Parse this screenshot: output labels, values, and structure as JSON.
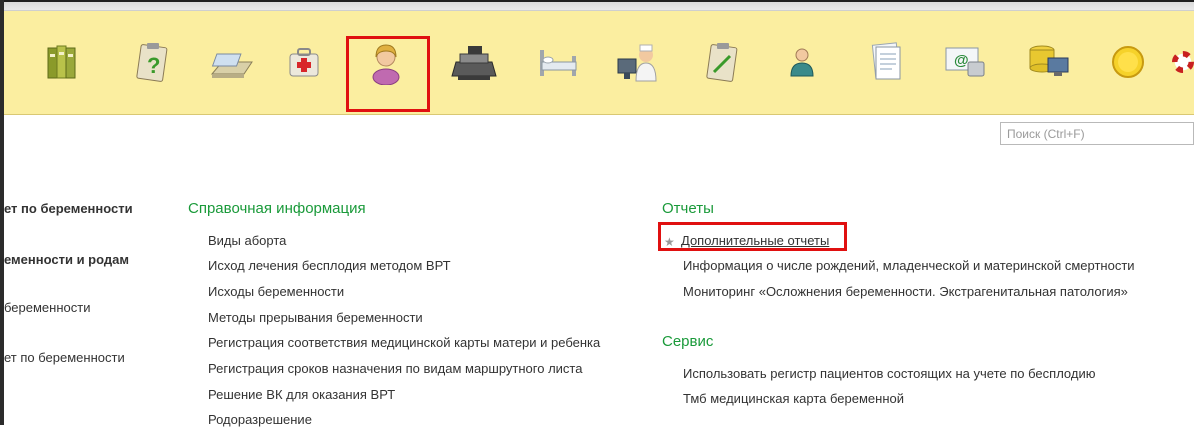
{
  "toolbar": {
    "icons": [
      {
        "name": "books-icon"
      },
      {
        "name": "clipboard-question-icon"
      },
      {
        "name": "document-tray-icon"
      },
      {
        "name": "medical-case-icon"
      },
      {
        "name": "woman-user-icon",
        "selected": true
      },
      {
        "name": "cash-register-icon"
      },
      {
        "name": "hospital-bed-icon"
      },
      {
        "name": "doctor-computer-icon"
      },
      {
        "name": "clipboard-edit-icon"
      },
      {
        "name": "person-icon"
      },
      {
        "name": "documents-stack-icon"
      },
      {
        "name": "mail-phone-icon"
      },
      {
        "name": "database-computer-icon"
      },
      {
        "name": "yellow-circle-icon"
      },
      {
        "name": "lifebuoy-icon"
      }
    ],
    "accent_color": "#fbeea0",
    "highlight_color": "#e01010"
  },
  "search": {
    "placeholder": "Поиск (Ctrl+F)"
  },
  "leftnav": {
    "items": [
      {
        "label": "ет по беременности",
        "bold": true
      },
      {
        "label": "еменности и родам",
        "bold": true
      },
      {
        "label": "беременности",
        "bold": false
      },
      {
        "label": "ет по беременности",
        "bold": false
      }
    ]
  },
  "reference": {
    "title": "Справочная информация",
    "items": [
      "Виды аборта",
      "Исход лечения бесплодия методом ВРТ",
      "Исходы беременности",
      "Методы прерывания беременности",
      "Регистрация соответствия медицинской карты матери и ребенка",
      "Регистрация сроков назначения по видам маршрутного листа",
      "Решение ВК для оказания ВРТ",
      "Родоразрешение"
    ]
  },
  "reports": {
    "title": "Отчеты",
    "items": [
      "Дополнительные отчеты",
      "Информация о числе рождений, младенческой и материнской смертности",
      "Мониторинг «Осложнения беременности. Экстрагенитальная патология»"
    ]
  },
  "service": {
    "title": "Сервис",
    "items": [
      "Использовать регистр пациентов состоящих на учете по бесплодию",
      "Тмб медицинская карта беременной"
    ]
  },
  "colors": {
    "section_title": "#1a9a3a",
    "text": "#333333"
  }
}
